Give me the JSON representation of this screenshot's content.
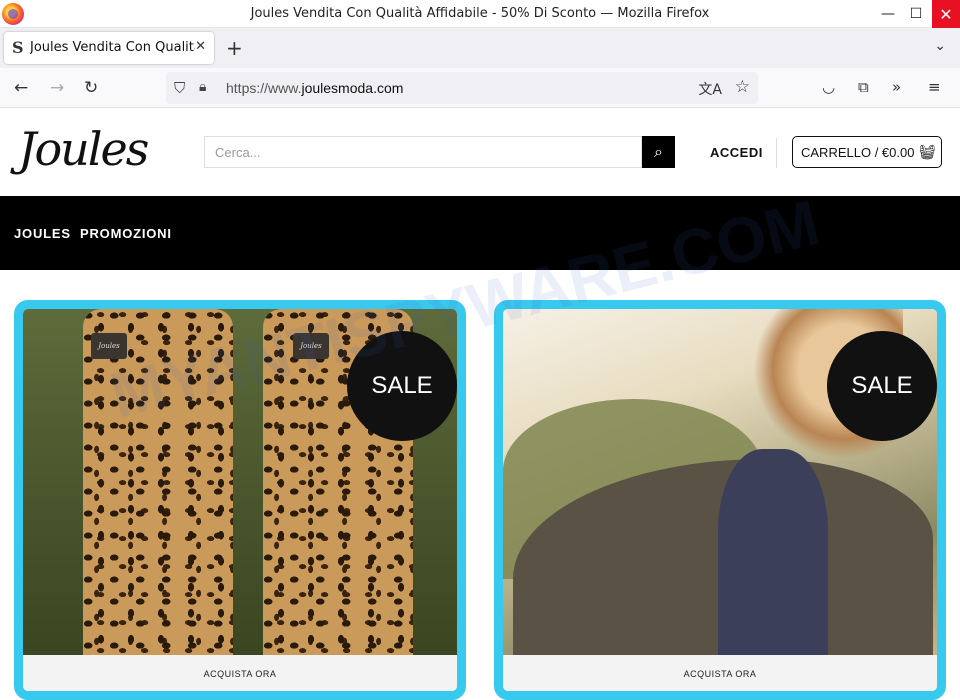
{
  "window": {
    "title": "Joules Vendita Con Qualità Affidabile - 50% Di Sconto — Mozilla Firefox",
    "minimize": "—",
    "maximize": "☐",
    "close": "✕"
  },
  "tabs": [
    {
      "title": "Joules Vendita Con Qualità Affidabile - 50% Di Sconto",
      "close": "✕"
    }
  ],
  "navbar": {
    "url_prefix": "https://www.",
    "url_host": "joulesmoda.com"
  },
  "site": {
    "logo": "Joules",
    "search_placeholder": "Cerca...",
    "login": "ACCEDI",
    "cart": "CARRELLO / €0.00"
  },
  "menu": {
    "items": [
      "JOULES",
      "PROMOZIONI"
    ]
  },
  "cards": [
    {
      "badge": "SALE",
      "cta": "ACQUISTA ORA"
    },
    {
      "badge": "SALE",
      "cta": "ACQUISTA ORA"
    }
  ],
  "watermark": "MYANTISPYWARE.COM",
  "colors": {
    "menu_bg": "#000000",
    "card_border": "#38c9ee",
    "badge_bg": "#111111",
    "close_button": "#e81123"
  },
  "icons": {
    "browser": "firefox-icon",
    "tab_favicon": "joules-favicon",
    "search": "magnifier-icon",
    "cart": "basket-icon"
  }
}
